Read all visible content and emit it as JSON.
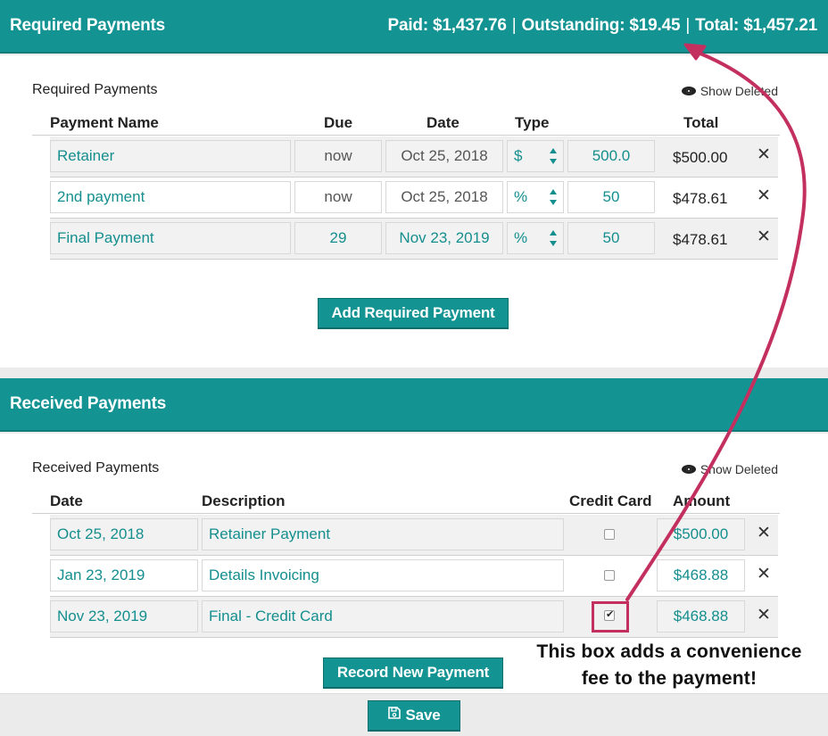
{
  "required": {
    "header_title": "Required Payments",
    "paid": "Paid: $1,437.76",
    "outstanding": "Outstanding: $19.45",
    "total": "Total: $1,457.21",
    "separator": "|",
    "sub_title": "Required Payments",
    "show_deleted": "Show Deleted",
    "columns": {
      "name": "Payment Name",
      "due": "Due",
      "date": "Date",
      "type": "Type",
      "total": "Total"
    },
    "rows": [
      {
        "name": "Retainer",
        "due": "now",
        "date": "Oct 25, 2018",
        "type": "$",
        "amount": "500.0",
        "total": "$500.00"
      },
      {
        "name": "2nd payment",
        "due": "now",
        "date": "Oct 25, 2018",
        "type": "%",
        "amount": "50",
        "total": "$478.61"
      },
      {
        "name": "Final Payment",
        "due": "29",
        "date": "Nov 23, 2019",
        "type": "%",
        "amount": "50",
        "total": "$478.61"
      }
    ],
    "add_button": "Add Required Payment"
  },
  "received": {
    "header_title": "Received Payments",
    "sub_title": "Received Payments",
    "show_deleted": "Show Deleted",
    "columns": {
      "date": "Date",
      "description": "Description",
      "credit_card": "Credit Card",
      "amount": "Amount"
    },
    "rows": [
      {
        "date": "Oct 25, 2018",
        "description": "Retainer Payment",
        "credit_card": false,
        "amount": "$500.00"
      },
      {
        "date": "Jan 23, 2019",
        "description": "Details Invoicing",
        "credit_card": false,
        "amount": "$468.88"
      },
      {
        "date": "Nov 23, 2019",
        "description": "Final - Credit Card",
        "credit_card": true,
        "amount": "$468.88"
      }
    ],
    "record_button": "Record New Payment"
  },
  "annotation": {
    "line1": "This box adds a convenience",
    "line2": "fee to the payment!",
    "accent": "#c3305f"
  },
  "footer": {
    "save_label": "Save"
  },
  "colors": {
    "teal": "#149393",
    "link": "#158e8e"
  },
  "icons": {
    "show_deleted": "eye-icon",
    "delete": "close-icon",
    "save": "floppy-disk-icon",
    "select": "up-down-arrows-icon"
  }
}
